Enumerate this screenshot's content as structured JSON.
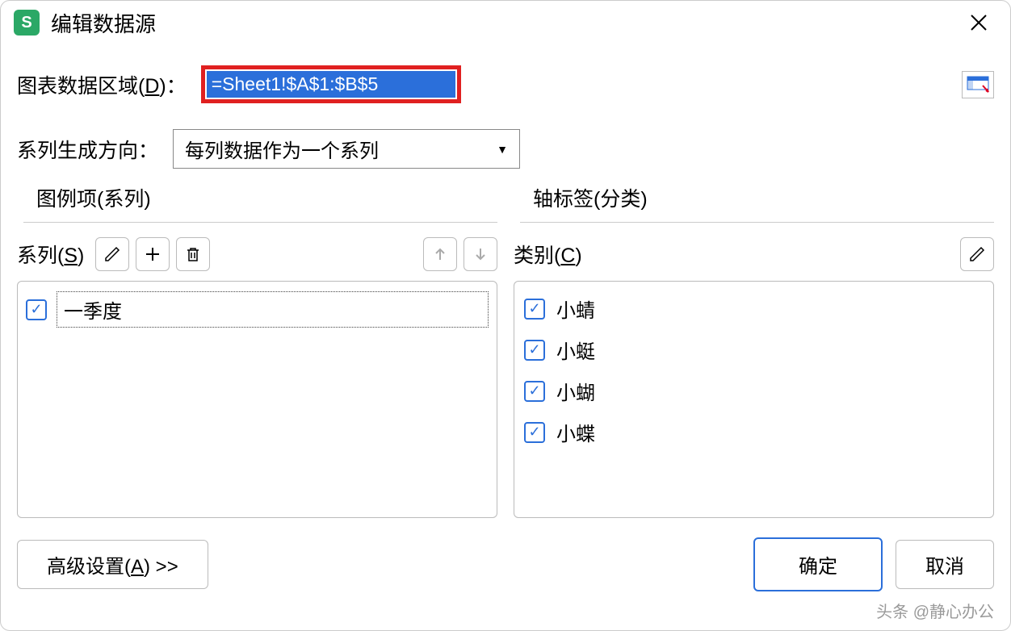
{
  "title": "编辑数据源",
  "chart_range": {
    "label_pre": "图表数据区域(",
    "label_u": "D",
    "label_post": ")：",
    "value": "=Sheet1!$A$1:$B$5"
  },
  "direction": {
    "label": "系列生成方向：",
    "value": "每列数据作为一个系列"
  },
  "series_panel": {
    "group_label": "图例项(系列)",
    "label_pre": "系列(",
    "label_u": "S",
    "label_post": ")",
    "items": [
      {
        "label": "一季度",
        "checked": true,
        "selected": true
      }
    ]
  },
  "category_panel": {
    "group_label": "轴标签(分类)",
    "label_pre": "类别(",
    "label_u": "C",
    "label_post": ")",
    "items": [
      {
        "label": "小蜻",
        "checked": true
      },
      {
        "label": "小蜓",
        "checked": true
      },
      {
        "label": "小蝴",
        "checked": true
      },
      {
        "label": "小蝶",
        "checked": true
      }
    ]
  },
  "footer": {
    "advanced_pre": "高级设置(",
    "advanced_u": "A",
    "advanced_post": ") >>",
    "ok": "确定",
    "cancel": "取消"
  },
  "watermark": "头条 @静心办公"
}
